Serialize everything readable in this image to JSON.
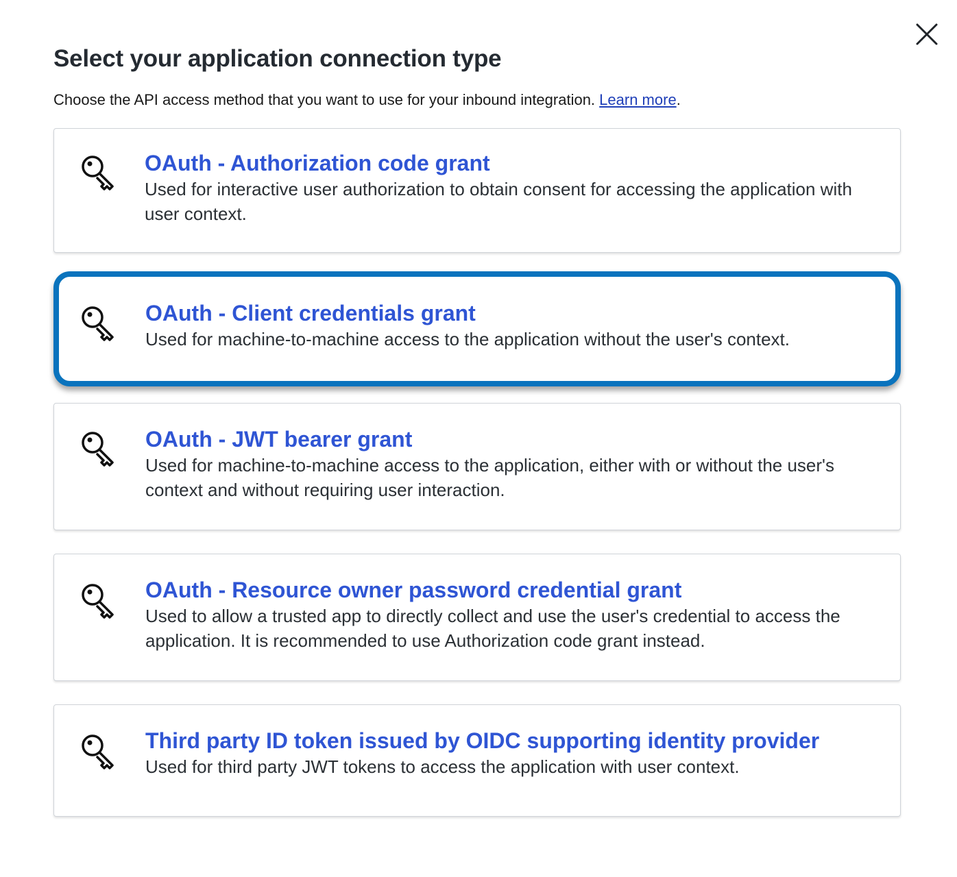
{
  "dialog": {
    "title": "Select your application connection type",
    "subtitle_text": "Choose the API access method that you want to use for your inbound integration.",
    "learn_more_label": "Learn more",
    "subtitle_period": ".",
    "close_icon": "close-icon",
    "accent_color": "#2f55d4",
    "selected_border_color": "#0a73bd"
  },
  "options": [
    {
      "title": "OAuth - Authorization code grant",
      "description": "Used for interactive user authorization to obtain consent for accessing the application with user context.",
      "icon": "key-icon",
      "selected": false
    },
    {
      "title": "OAuth - Client credentials grant",
      "description": "Used for machine-to-machine access to the application without the user's context.",
      "icon": "key-icon",
      "selected": true
    },
    {
      "title": "OAuth - JWT bearer grant",
      "description": "Used for machine-to-machine access to the application, either with or without the user's context and without requiring user interaction.",
      "icon": "key-icon",
      "selected": false
    },
    {
      "title": "OAuth - Resource owner password credential grant",
      "description": "Used to allow a trusted app to directly collect and use the user's credential to access the application. It is recommended to use Authorization code grant instead.",
      "icon": "key-icon",
      "selected": false
    },
    {
      "title": "Third party ID token issued by OIDC supporting identity provider",
      "description": "Used for third party JWT tokens to access the application with user context.",
      "icon": "key-icon",
      "selected": false
    }
  ]
}
